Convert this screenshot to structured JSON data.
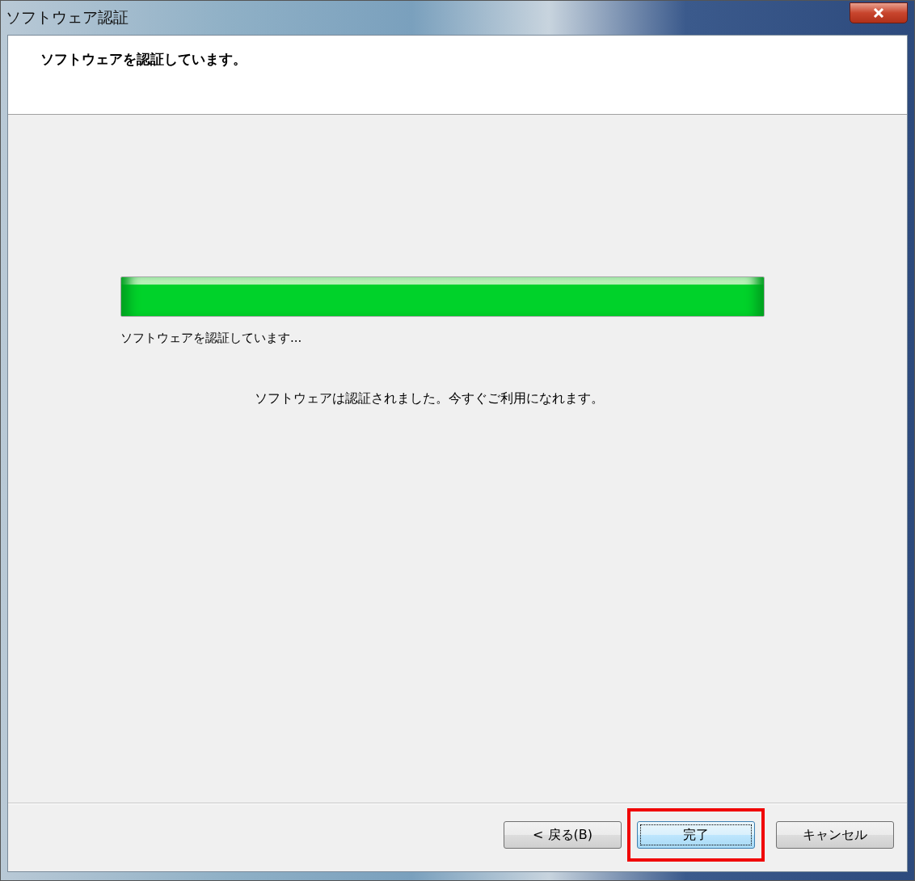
{
  "window": {
    "title": "ソフトウェア認証"
  },
  "header": {
    "title": "ソフトウェアを認証しています。"
  },
  "progress": {
    "level": 1,
    "status": "ソフトウェアを認証しています..."
  },
  "message": "ソフトウェアは認証されました。今すぐご利用になれます。",
  "buttons": [
    {
      "label": "< 戻る(B)",
      "default": false,
      "highlighted": false
    },
    {
      "label": "完了",
      "default": true,
      "highlighted": true
    },
    {
      "label": "キャンセル",
      "default": false,
      "highlighted": false
    }
  ]
}
